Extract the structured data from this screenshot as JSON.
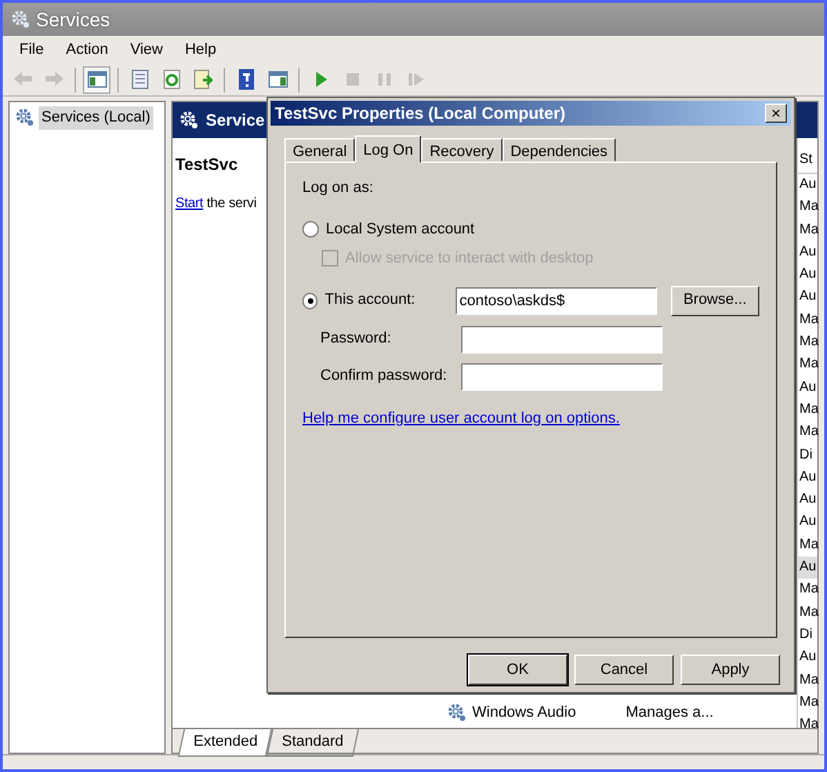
{
  "window": {
    "title": "Services"
  },
  "menu": [
    "File",
    "Action",
    "View",
    "Help"
  ],
  "toolbar": [
    {
      "kind": "back",
      "disabled": true
    },
    {
      "kind": "forward",
      "disabled": true
    },
    {
      "kind": "sep"
    },
    {
      "kind": "tree",
      "disabled": false
    },
    {
      "kind": "sep"
    },
    {
      "kind": "export",
      "disabled": false
    },
    {
      "kind": "refresh",
      "disabled": false
    },
    {
      "kind": "list",
      "disabled": false
    },
    {
      "kind": "sep"
    },
    {
      "kind": "help",
      "disabled": false
    },
    {
      "kind": "pane",
      "disabled": false
    },
    {
      "kind": "sep"
    },
    {
      "kind": "play",
      "disabled": false
    },
    {
      "kind": "stop",
      "disabled": true
    },
    {
      "kind": "pause",
      "disabled": true
    },
    {
      "kind": "resume",
      "disabled": true
    }
  ],
  "tree": [
    {
      "label": "Services (Local)",
      "selected": true
    }
  ],
  "pane": {
    "header": "Service",
    "service_name": "TestSvc",
    "action_link": "Start",
    "action_text": "the servi"
  },
  "status_column": {
    "header": "St",
    "rows": [
      {
        "text": "Au",
        "selected": false
      },
      {
        "text": "Ma",
        "selected": false
      },
      {
        "text": "Ma",
        "selected": false
      },
      {
        "text": "Au",
        "selected": false
      },
      {
        "text": "Au",
        "selected": false
      },
      {
        "text": "Au",
        "selected": false
      },
      {
        "text": "Ma",
        "selected": false
      },
      {
        "text": "Ma",
        "selected": false
      },
      {
        "text": "Ma",
        "selected": false
      },
      {
        "text": "Au",
        "selected": false
      },
      {
        "text": "Ma",
        "selected": false
      },
      {
        "text": "Ma",
        "selected": false
      },
      {
        "text": "Di",
        "selected": false
      },
      {
        "text": "Au",
        "selected": false
      },
      {
        "text": "Au",
        "selected": false
      },
      {
        "text": "Au",
        "selected": false
      },
      {
        "text": "Ma",
        "selected": false
      },
      {
        "text": "Au",
        "selected": true
      },
      {
        "text": "Ma",
        "selected": false
      },
      {
        "text": "Ma",
        "selected": false
      },
      {
        "text": "Di",
        "selected": false
      },
      {
        "text": "Au",
        "selected": false
      },
      {
        "text": "Ma",
        "selected": false
      },
      {
        "text": "Ma",
        "selected": false
      },
      {
        "text": "Ma",
        "selected": false
      }
    ]
  },
  "services": [
    {
      "name": "Windows Audio",
      "description": "Manages a..."
    }
  ],
  "view_tabs": [
    {
      "label": "Extended",
      "selected": true
    },
    {
      "label": "Standard",
      "selected": false
    }
  ],
  "dialog": {
    "title": "TestSvc Properties (Local Computer)",
    "close": "×",
    "tabs": [
      {
        "label": "General",
        "selected": false
      },
      {
        "label": "Log On",
        "selected": true
      },
      {
        "label": "Recovery",
        "selected": false
      },
      {
        "label": "Dependencies",
        "selected": false
      }
    ],
    "group_label": "Log on as:",
    "options": [
      {
        "kind": "radio",
        "label": "Local System account",
        "checked": false
      },
      {
        "kind": "checkbox",
        "label": "Allow service to interact with desktop",
        "checked": false,
        "disabled": true
      },
      {
        "kind": "account",
        "label": "This account:",
        "checked": true,
        "value": "contoso\\askds$",
        "button": "Browse..."
      },
      {
        "kind": "password",
        "label": "Password:"
      },
      {
        "kind": "password",
        "label": "Confirm password:"
      }
    ],
    "help_link": "Help me configure user account log on options.",
    "buttons": [
      {
        "label": "OK",
        "default": true
      },
      {
        "label": "Cancel",
        "default": false
      },
      {
        "label": "Apply",
        "default": false
      }
    ]
  }
}
